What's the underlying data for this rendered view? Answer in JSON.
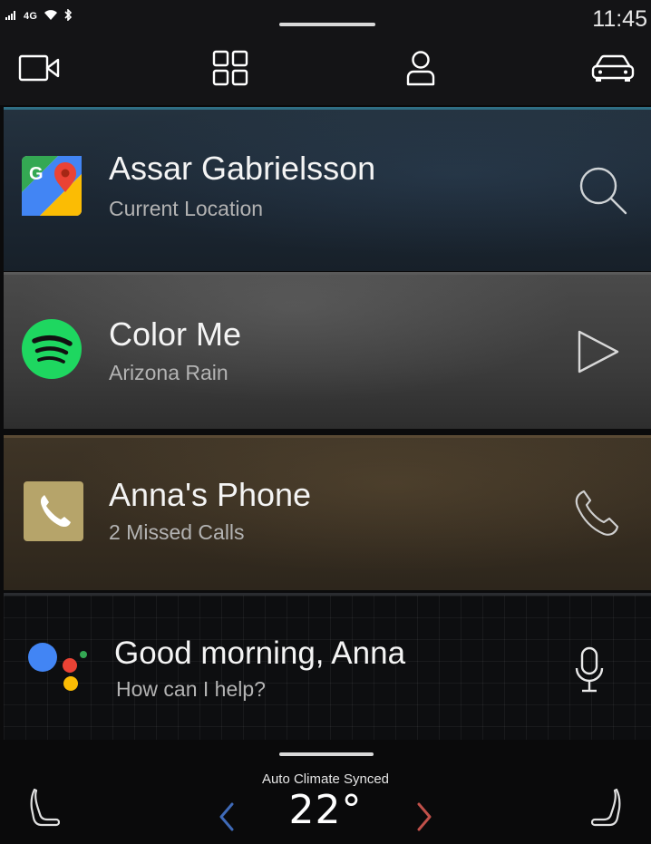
{
  "status": {
    "network": "4G",
    "time": "11:45"
  },
  "nav": {
    "icons": [
      "camera-icon",
      "apps-grid-icon",
      "profile-icon",
      "car-icon"
    ]
  },
  "tiles": {
    "navigation": {
      "title": "Assar Gabrielsson",
      "subtitle": "Current Location",
      "app_icon": "google-maps-icon",
      "action_icon": "search-icon"
    },
    "music": {
      "title": "Color Me",
      "subtitle": "Arizona Rain",
      "app_icon": "spotify-icon",
      "action_icon": "play-icon"
    },
    "phone": {
      "title": "Anna's Phone",
      "subtitle": "2 Missed Calls",
      "app_icon": "phone-app-icon",
      "action_icon": "phone-icon"
    },
    "assistant": {
      "title": "Good morning, Anna",
      "subtitle": "How can I help?",
      "app_icon": "google-assistant-icon",
      "action_icon": "microphone-icon"
    }
  },
  "climate": {
    "label": "Auto Climate Synced",
    "temperature": "22°",
    "left_arrow_color": "#3f6ab8",
    "right_arrow_color": "#c0504a"
  },
  "colors": {
    "accent_nav": "#2f6e84",
    "spotify_green": "#1ed760",
    "phone_gold": "#b6a46a"
  }
}
